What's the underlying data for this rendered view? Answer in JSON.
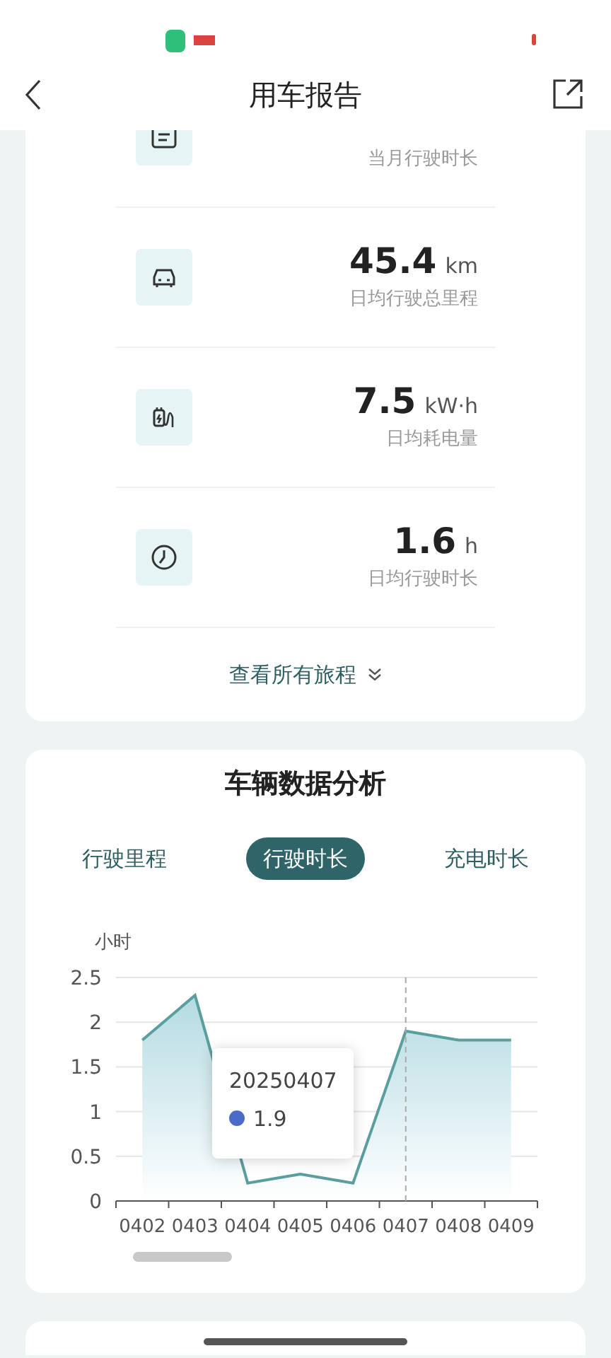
{
  "header": {
    "title": "用车报告"
  },
  "summary": {
    "rows": [
      {
        "kind": "doc",
        "label": "当月行驶时长"
      },
      {
        "kind": "car",
        "value": "45.4",
        "unit": "km",
        "label": "日均行驶总里程"
      },
      {
        "kind": "charge",
        "value": "7.5",
        "unit": "kW·h",
        "label": "日均耗电量"
      },
      {
        "kind": "clock",
        "value": "1.6",
        "unit": "h",
        "label": "日均行驶时长"
      }
    ],
    "link": "查看所有旅程"
  },
  "analysis": {
    "title": "车辆数据分析",
    "tabs": [
      {
        "label": "行驶里程",
        "selected": false
      },
      {
        "label": "行驶时长",
        "selected": true
      },
      {
        "label": "充电时长",
        "selected": false
      }
    ],
    "chart_data": {
      "type": "area",
      "ylabel": "小时",
      "categories": [
        "0402",
        "0403",
        "0404",
        "0405",
        "0406",
        "0407",
        "0408",
        "0409"
      ],
      "series": [
        {
          "color": "#5b9ea0",
          "values": [
            1.8,
            2.3,
            0.2,
            0.3,
            0.2,
            1.9,
            1.8,
            1.8
          ]
        }
      ],
      "ylim": [
        0,
        2.5
      ],
      "yticks": [
        0,
        0.5,
        1,
        1.5,
        2,
        2.5
      ],
      "grid": true,
      "ref_lines": [
        {
          "axis": "x",
          "value": "0407",
          "color": "#aaaaaa"
        }
      ]
    },
    "tooltip": {
      "title": "20250407",
      "value": "1.9",
      "color": "#4a6bc7"
    }
  }
}
